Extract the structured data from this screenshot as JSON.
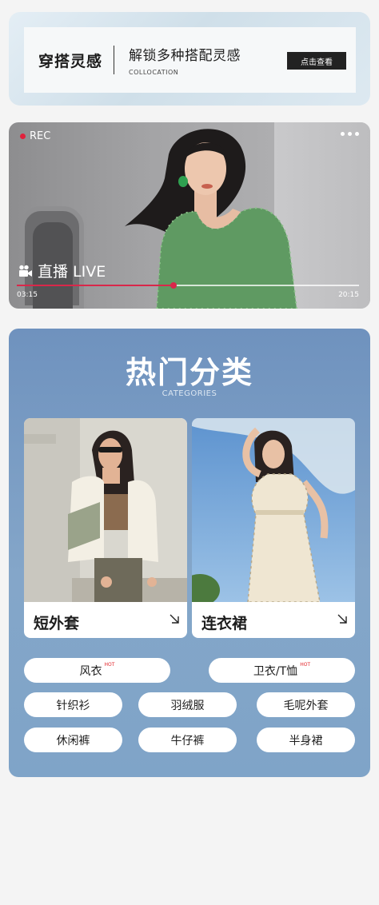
{
  "banner": {
    "title": "穿搭灵感",
    "subtitle": "解锁多种搭配灵感",
    "subtitle_en": "COLLOCATION",
    "button_label": "点击查看"
  },
  "live": {
    "rec_label": "REC",
    "live_label": "直播 LIVE",
    "time_current": "03:15",
    "time_total": "20:15",
    "progress_fraction": 0.457,
    "accent_color": "#d9274a"
  },
  "categories": {
    "title": "热门分类",
    "title_en": "CATEGORIES",
    "cards": [
      {
        "label": "短外套",
        "icon": "arrow-down-right-icon"
      },
      {
        "label": "连衣裙",
        "icon": "arrow-down-right-icon"
      }
    ],
    "tags": [
      {
        "label": "风衣",
        "badge": "HOT"
      },
      {
        "label": "卫衣/T恤",
        "badge": "HOT"
      },
      {
        "label": "针织衫"
      },
      {
        "label": "羽绒服"
      },
      {
        "label": "毛呢外套"
      },
      {
        "label": "休闲裤"
      },
      {
        "label": "牛仔裤"
      },
      {
        "label": "半身裙"
      }
    ]
  }
}
